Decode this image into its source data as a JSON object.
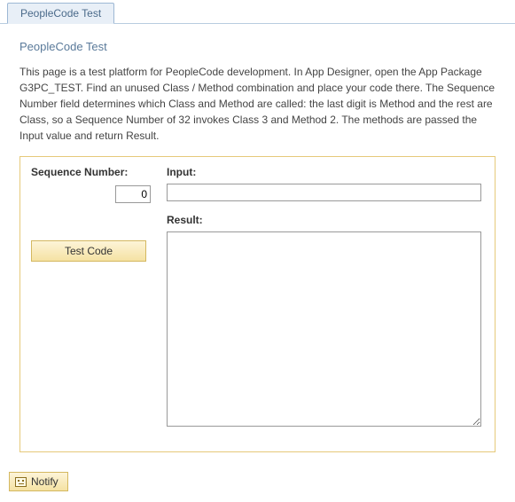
{
  "tab": {
    "label": "PeopleCode Test"
  },
  "page": {
    "title": "PeopleCode Test",
    "description": "This page is a test platform for PeopleCode development. In App Designer, open the App Package G3PC_TEST. Find an unused Class / Method combination and place your code there. The Sequence Number field determines which Class and Method are called: the last digit is Method and the rest are Class, so a Sequence Number of 32 invokes Class 3 and Method 2. The methods are passed the Input value and return Result."
  },
  "form": {
    "sequence_label": "Sequence Number:",
    "sequence_value": "0",
    "input_label": "Input:",
    "input_value": "",
    "result_label": "Result:",
    "result_value": "",
    "test_button": "Test Code"
  },
  "footer": {
    "notify_label": "Notify"
  }
}
